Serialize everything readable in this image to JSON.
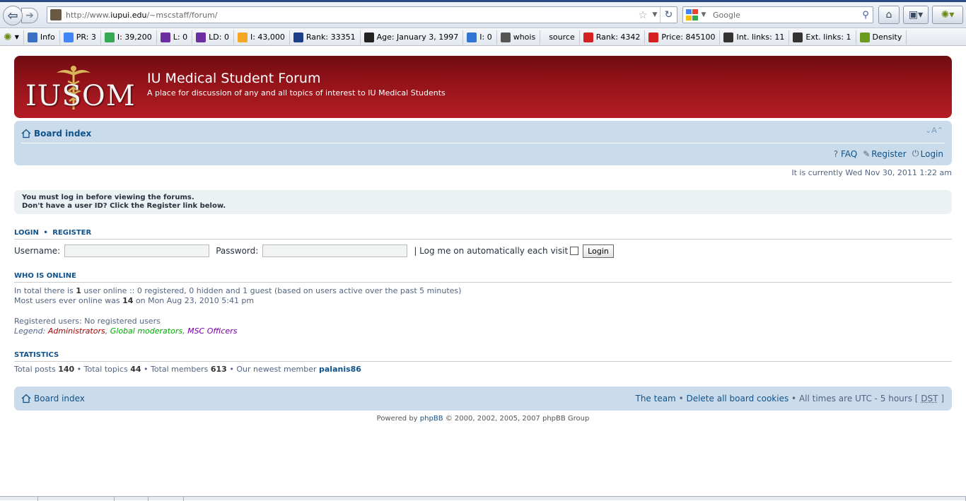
{
  "browser": {
    "back_icon": "back-arrow-icon",
    "forward_icon": "forward-arrow-icon",
    "url_prefix": "http://www.",
    "url_host": "iupui.edu",
    "url_path": "/~mscstaff/forum/",
    "search_placeholder": "Google"
  },
  "seo_toolbar": {
    "items": [
      {
        "label": "Info",
        "icon": "info-icon",
        "color": "#3b6fc4"
      },
      {
        "label": "PR: 3",
        "icon": "google-icon",
        "color": "#4285f4"
      },
      {
        "label": "I: 39,200",
        "icon": "google-index-icon",
        "color": "#34a853"
      },
      {
        "label": "L: 0",
        "icon": "yahoo-icon",
        "color": "#6b2fa0"
      },
      {
        "label": "LD: 0",
        "icon": "yahoo-icon",
        "color": "#6b2fa0"
      },
      {
        "label": "I: 43,000",
        "icon": "bing-icon",
        "color": "#f5a623"
      },
      {
        "label": "Rank: 33351",
        "icon": "alexa-icon",
        "color": "#1d3f8a"
      },
      {
        "label": "Age: January 3, 1997",
        "icon": "archive-icon",
        "color": "#222222"
      },
      {
        "label": "I: 0",
        "icon": "delicious-icon",
        "color": "#3274d1"
      },
      {
        "label": "whois",
        "icon": "fingerprint-icon",
        "color": "#555555"
      },
      {
        "label": "source",
        "icon": "",
        "color": ""
      },
      {
        "label": "Rank: 4342",
        "icon": "compete-icon",
        "color": "#d42020"
      },
      {
        "label": "Price: 845100",
        "icon": "price-icon",
        "color": "#d42020"
      },
      {
        "label": "Int. links: 11",
        "icon": "hand-pointer-icon",
        "color": "#333333"
      },
      {
        "label": "Ext. links: 1",
        "icon": "hand-pointer-icon",
        "color": "#333333"
      },
      {
        "label": "Density",
        "icon": "bar-chart-icon",
        "color": "#6a9a20"
      }
    ]
  },
  "header": {
    "logo_text": "IUSOM",
    "title": "IU Medical Student Forum",
    "description": "A place for discussion of any and all topics of interest to IU Medical Students",
    "bg_color": "#a3171d"
  },
  "navbar": {
    "board_index": "Board index",
    "faq": "FAQ",
    "register": "Register",
    "login": "Login",
    "font_resize": "A"
  },
  "current_time": "It is currently Wed Nov 30, 2011 1:22 am",
  "notice": {
    "line1": "You must log in before viewing the forums.",
    "line2": "Don't have a user ID?  Click the Register link below."
  },
  "login": {
    "head_login": "LOGIN",
    "head_sep": "•",
    "head_register": "REGISTER",
    "username_label": "Username:",
    "password_label": "Password:",
    "autologin_label": "| Log me on automatically each visit",
    "submit_label": "Login"
  },
  "who_is_online": {
    "head": "WHO IS ONLINE",
    "total_prefix": "In total there is",
    "total_count": "1",
    "total_suffix": "user online :: 0 registered, 0 hidden and 1 guest (based on users active over the past 5 minutes)",
    "most_prefix": "Most users ever online was",
    "most_count": "14",
    "most_suffix": "on Mon Aug 23, 2010 5:41 pm",
    "registered_users": "Registered users: No registered users",
    "legend_label": "Legend:",
    "legend_admin": "Administrators",
    "legend_gmod": "Global moderators",
    "legend_msc": "MSC Officers"
  },
  "statistics": {
    "head": "STATISTICS",
    "posts_label": "Total posts",
    "posts": "140",
    "topics_label": "Total topics",
    "topics": "44",
    "members_label": "Total members",
    "members": "613",
    "newest_label": "Our newest member",
    "newest": "palanis86"
  },
  "footer": {
    "board_index": "Board index",
    "team": "The team",
    "delete_cookies": "Delete all board cookies",
    "timezone_prefix": "All times are UTC - 5 hours [",
    "dst": "DST",
    "timezone_suffix": "]",
    "powered_prefix": "Powered by",
    "phpbb": "phpBB",
    "copyright_suffix": "© 2000, 2002, 2005, 2007 phpBB Group"
  }
}
